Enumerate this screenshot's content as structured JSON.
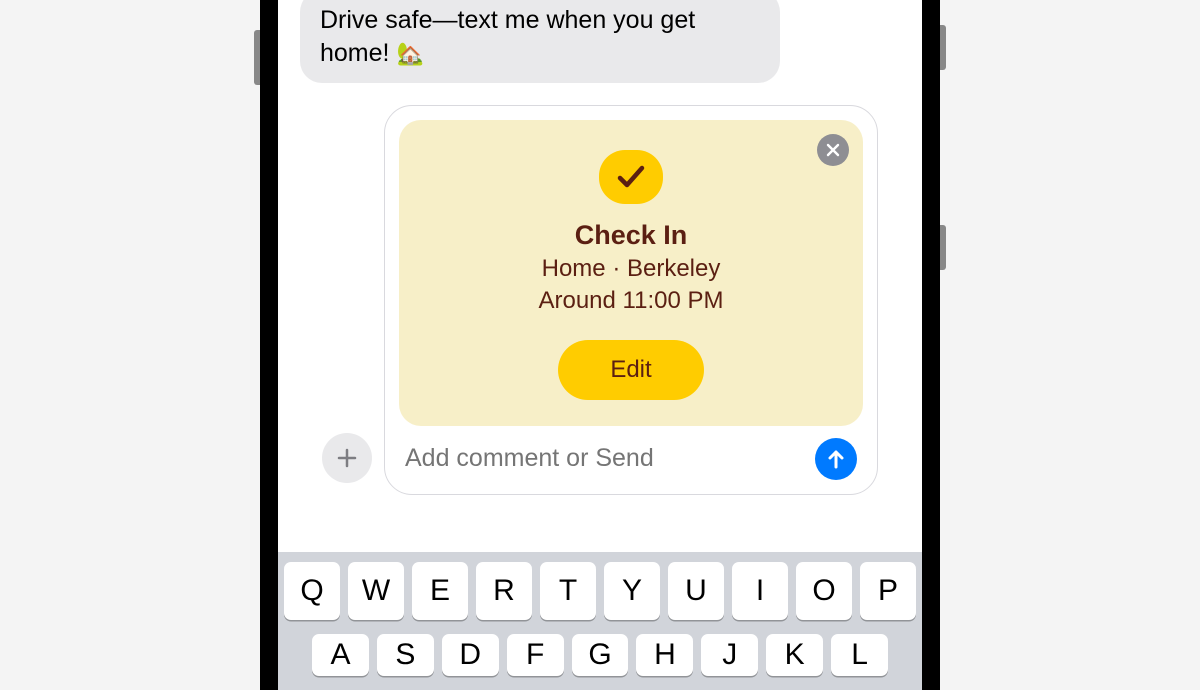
{
  "chat": {
    "incoming_message": "Drive safe—text me when you get home!",
    "incoming_emoji": "🏡"
  },
  "checkin": {
    "title": "Check In",
    "location": "Home · Berkeley",
    "time": "Around 11:00 PM",
    "edit_label": "Edit"
  },
  "compose": {
    "placeholder": "Add comment or Send"
  },
  "keyboard": {
    "row1": [
      "Q",
      "W",
      "E",
      "R",
      "T",
      "Y",
      "U",
      "I",
      "O",
      "P"
    ],
    "row2": [
      "A",
      "S",
      "D",
      "F",
      "G",
      "H",
      "J",
      "K",
      "L"
    ]
  }
}
